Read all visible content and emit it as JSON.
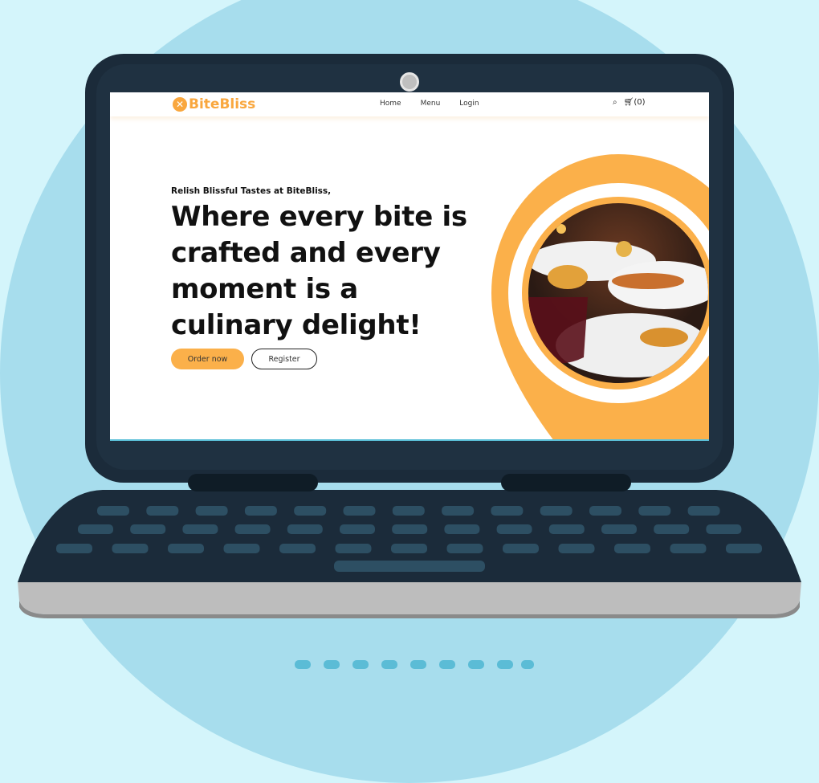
{
  "site": {
    "brand": "BiteBliss",
    "logo_icon": "x-circle-icon",
    "accent": "#f9a73e"
  },
  "nav": {
    "links": [
      "Home",
      "Menu",
      "Login"
    ],
    "search_icon": "search-icon",
    "cart_icon": "cart-icon",
    "cart_count": "(0)"
  },
  "hero": {
    "tagline": "Relish Blissful Tastes at BiteBliss,",
    "headline": "Where every bite is crafted and every moment is a culinary delight!",
    "order_button": "Order now",
    "register_button": "Register"
  },
  "colors": {
    "laptop": "#1b2b3a",
    "background": "#d4f5fb",
    "circle": "#a7dded",
    "keys": "#2d4f63"
  }
}
